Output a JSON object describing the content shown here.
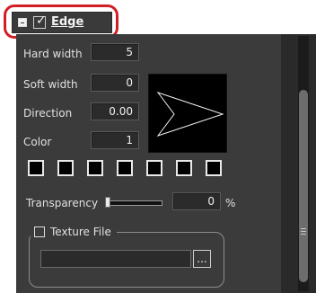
{
  "header": {
    "title": "Edge",
    "icons": {
      "collapse": "minus-square-icon",
      "checkbox": "checkbox-checked-icon"
    }
  },
  "fields": {
    "hard_width": {
      "label": "Hard width",
      "value": "5"
    },
    "soft_width": {
      "label": "Soft width",
      "value": "0"
    },
    "direction": {
      "label": "Direction",
      "value": "0.00"
    },
    "color": {
      "label": "Color",
      "value": "1"
    }
  },
  "swatches": [
    "#000000",
    "#000000",
    "#000000",
    "#000000",
    "#000000",
    "#000000",
    "#000000"
  ],
  "transparency": {
    "label": "Transparency",
    "value": "0",
    "unit": "%",
    "level": 0
  },
  "texture": {
    "title": "Texture File",
    "path": "",
    "browse": "..."
  },
  "colors": {
    "highlight_ring": "#d21f26",
    "panel_bg": "#3b3b3b",
    "field_bg": "#2b2b2b",
    "text": "#e0e0e0"
  }
}
